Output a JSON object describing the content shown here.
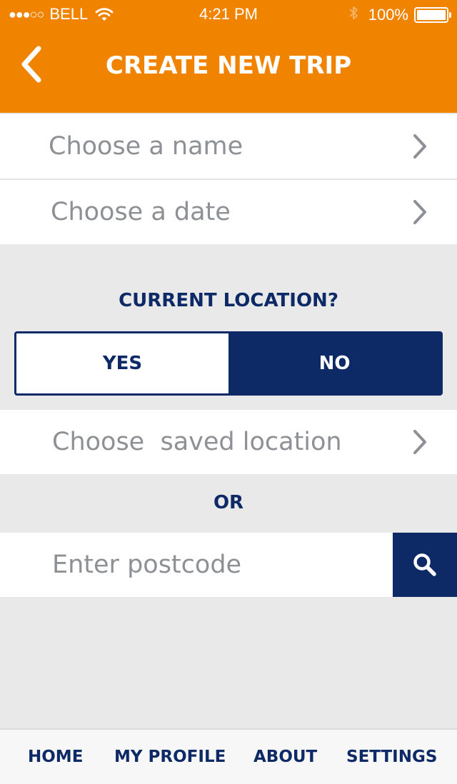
{
  "colors": {
    "header_bg": "#f08300",
    "navy": "#0e2a66",
    "placeholder_gray": "#8d9094",
    "background": "#e9e9e9"
  },
  "status_bar": {
    "signal_dots": "●●●○○",
    "carrier": "BELL",
    "wifi_icon": "wifi-icon",
    "time": "4:21 PM",
    "bluetooth_icon": "bluetooth-icon",
    "battery_percent": "100%"
  },
  "header": {
    "back_icon": "chevron-left-icon",
    "title": "CREATE NEW TRIP"
  },
  "form": {
    "name_row": {
      "label": "Choose a name"
    },
    "date_row": {
      "label": "Choose a date"
    },
    "current_location": {
      "question": "CURRENT LOCATION?",
      "yes_label": "YES",
      "no_label": "NO",
      "selected": "NO"
    },
    "saved_location_row": {
      "label": "Choose  saved location"
    },
    "or_label": "OR",
    "postcode": {
      "placeholder": "Enter postcode",
      "value": ""
    },
    "search_icon": "search-icon"
  },
  "tabbar": {
    "items": [
      {
        "label": "HOME"
      },
      {
        "label": "MY PROFILE"
      },
      {
        "label": "ABOUT"
      },
      {
        "label": "SETTINGS"
      }
    ]
  }
}
